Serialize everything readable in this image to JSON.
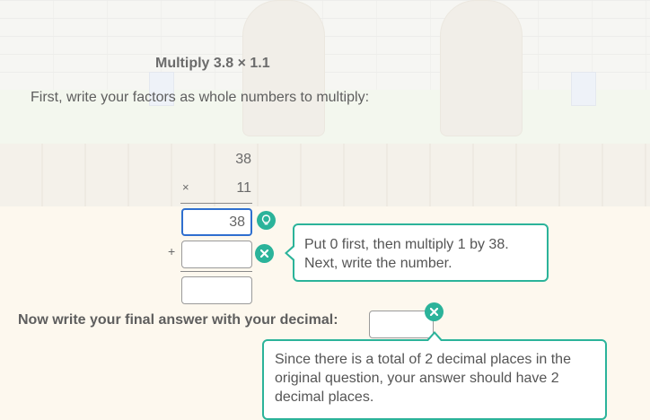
{
  "problem": {
    "title": "Multiply 3.8 × 1.1"
  },
  "instruction": "First, write your factors as whole numbers to multiply:",
  "multiplication": {
    "factor_top": "38",
    "factor_bottom": "11",
    "times_sign": "×",
    "plus_sign": "+",
    "partial_product_1": "38",
    "partial_product_2": "",
    "sum": ""
  },
  "final_answer": {
    "prompt": "Now write your final answer with your decimal:",
    "value": ""
  },
  "hints": {
    "partial_product_2": "Put 0 first, then multiply 1 by 38. Next, write the number.",
    "final_answer": "Since there is a total of 2 decimal places in the original question, your answer should have 2 decimal places."
  },
  "icons": {
    "hint": "lightbulb-icon",
    "error": "close-icon",
    "accent_color": "#2bb39a"
  }
}
